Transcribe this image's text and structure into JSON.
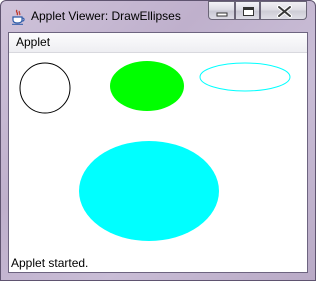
{
  "window": {
    "title": "Applet Viewer: DrawEllipses",
    "icon": "java-cup-icon",
    "controls": [
      "minimize-icon",
      "maximize-icon",
      "close-icon"
    ]
  },
  "menubar": {
    "items": [
      {
        "label": "Applet"
      }
    ]
  },
  "applet": {
    "shapes": [
      {
        "kind": "ellipse",
        "style": "outline",
        "color": "#000000"
      },
      {
        "kind": "ellipse",
        "style": "filled",
        "color": "#00ff00"
      },
      {
        "kind": "ellipse",
        "style": "outline",
        "color": "#00ffff"
      },
      {
        "kind": "ellipse",
        "style": "filled",
        "color": "#00ffff"
      }
    ]
  },
  "status": {
    "text": "Applet started."
  }
}
